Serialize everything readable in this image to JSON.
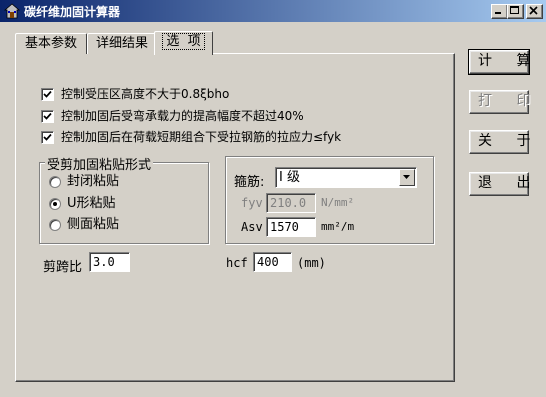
{
  "window": {
    "title": "碳纤维加固计算器",
    "icon": "app-house-icon"
  },
  "tabs": [
    {
      "label": "基本参数",
      "active": false
    },
    {
      "label": "详细结果",
      "active": false
    },
    {
      "label": "选  项",
      "active": true
    }
  ],
  "options": {
    "checkboxes": [
      {
        "label": "控制受压区高度不大于0.8ξbho",
        "checked": true
      },
      {
        "label": "控制加固后受弯承载力的提高幅度不超过40%",
        "checked": true
      },
      {
        "label": "控制加固后在荷载短期组合下受拉钢筋的拉应力≤fyk",
        "checked": true
      }
    ],
    "shear_group": {
      "title": "受剪加固粘贴形式",
      "options": [
        {
          "label": "封闭粘贴",
          "selected": false
        },
        {
          "label": "U形粘贴",
          "selected": true
        },
        {
          "label": "侧面粘贴",
          "selected": false
        }
      ]
    },
    "stirrup": {
      "label": "箍筋:",
      "selected": "I 级",
      "fyv_label": "fyv",
      "fyv_value": "210.0",
      "fyv_unit": "N/mm²",
      "asv_label": "Asv",
      "asv_value": "1570",
      "asv_unit": "mm²/m"
    },
    "shear_span": {
      "label": "剪跨比",
      "value": "3.0"
    },
    "hcf": {
      "label": "hcf",
      "value": "400",
      "unit": "(mm)"
    }
  },
  "buttons": {
    "calculate": "计 算",
    "print": "打 印",
    "about": "关 于",
    "exit": "退 出"
  },
  "colors": {
    "face": "#d4d0c8",
    "title_start": "#0a246a",
    "title_end": "#a6caf0"
  }
}
